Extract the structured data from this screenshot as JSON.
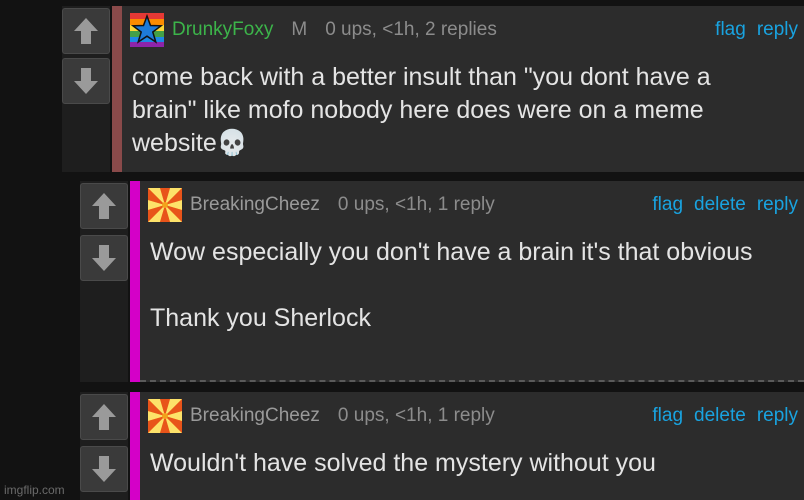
{
  "comments": [
    {
      "username": "DrunkyFoxy",
      "mod_mark": "M",
      "stats": "0 ups, <1h, 2 replies",
      "actions": {
        "flag": "flag",
        "reply": "reply"
      },
      "text": "come back with a better insult than \"you dont have a brain\" like mofo nobody here does were on a meme website💀",
      "accent_color": "#8a4a4a",
      "avatar_icon": "rainbow-star-icon"
    },
    {
      "username": "BreakingCheez",
      "stats": "0 ups, <1h, 1 reply",
      "actions": {
        "flag": "flag",
        "delete": "delete",
        "reply": "reply"
      },
      "text": "Wow especially you don't have a brain it's that obvious\n\nThank you Sherlock",
      "accent_color": "#d400c8",
      "avatar_icon": "sunburst-icon"
    },
    {
      "username": "BreakingCheez",
      "stats": "0 ups, <1h, 1 reply",
      "actions": {
        "flag": "flag",
        "delete": "delete",
        "reply": "reply"
      },
      "text": "Wouldn't have solved the mystery without you",
      "accent_color": "#d400c8",
      "avatar_icon": "sunburst-icon"
    }
  ],
  "vote": {
    "up_icon": "upvote-arrow-icon",
    "down_icon": "downvote-arrow-icon"
  },
  "watermark": "imgflip.com"
}
